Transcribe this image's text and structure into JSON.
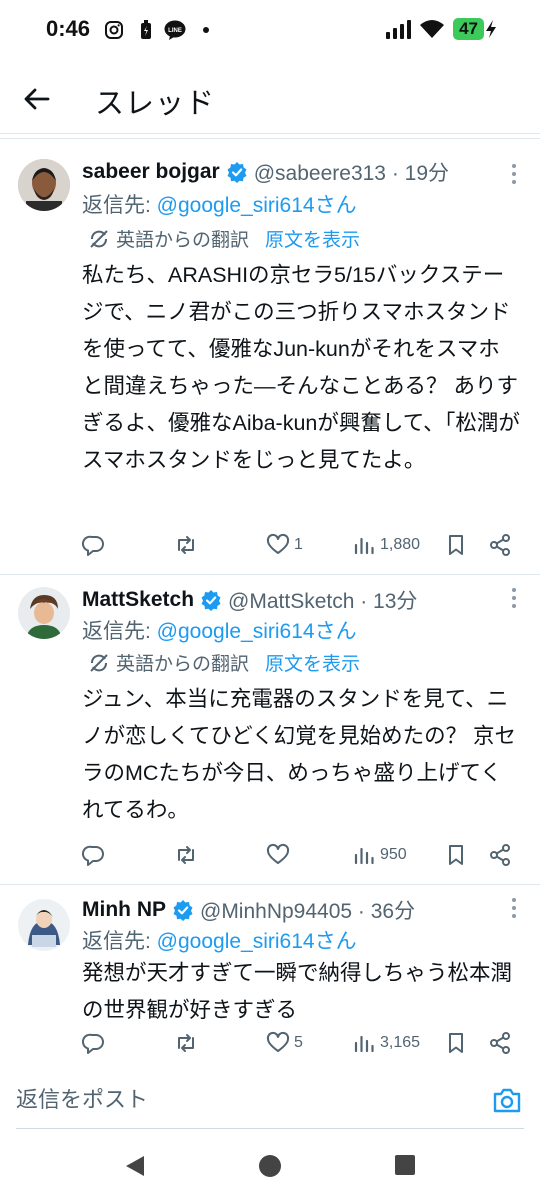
{
  "status_bar": {
    "time": "0:46",
    "battery": "47",
    "app_icons": [
      "instagram-icon",
      "battery-saver-icon",
      "line-icon",
      "dot-icon"
    ]
  },
  "header": {
    "title": "スレッド",
    "back_icon": "back-arrow-icon"
  },
  "tweets": [
    {
      "name": "sabeer bojgar",
      "handle": "@sabeere313 · 19分",
      "reply_prefix": "返信先: ",
      "reply_to": "@google_siri614さん",
      "translated_label": "英語からの翻訳",
      "show_original": "原文を表示",
      "body": "私たち、ARASHIの京セラ5/15バックステージで、ニノ君がこの三つ折りスマホスタンドを使ってて、優雅なJun-kunがそれをスマホと間違えちゃった—そんなことある？ ありすぎるよ、優雅なAiba-kunが興奮して、「松潤がスマホスタンドをじっと見てたよ。",
      "likes": "1",
      "views": "1,880"
    },
    {
      "name": "MattSketch",
      "handle": "@MattSketch · 13分",
      "reply_prefix": "返信先: ",
      "reply_to": "@google_siri614さん",
      "translated_label": "英語からの翻訳",
      "show_original": "原文を表示",
      "body": "ジュン、本当に充電器のスタンドを見て、ニノが恋しくてひどく幻覚を見始めたの？ 京セラのMCたちが今日、めっちゃ盛り上げてくれてるわ。",
      "likes": "",
      "views": "950"
    },
    {
      "name": "Minh NP",
      "handle": "@MinhNp94405 · 36分",
      "reply_prefix": "返信先: ",
      "reply_to": "@google_siri614さん",
      "body": "発想が天才すぎて一瞬で納得しちゃう松本潤の世界観が好きすぎる",
      "likes": "5",
      "views": "3,165"
    }
  ],
  "reply_bar": {
    "placeholder": "返信をポスト"
  },
  "colors": {
    "accent": "#1d9bf0",
    "text": "#0f1419",
    "secondary": "#536471",
    "battery": "#3ccb5a"
  }
}
